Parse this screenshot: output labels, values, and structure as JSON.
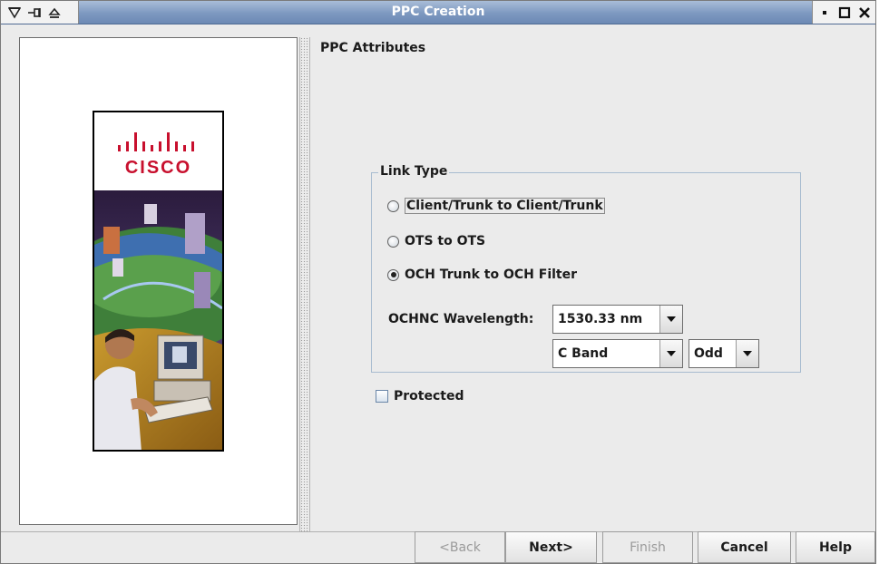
{
  "window": {
    "title": "PPC Creation",
    "left_icons": [
      "menu-triangle-icon",
      "pin-icon",
      "eject-icon"
    ],
    "right_icons": [
      "minimize-icon",
      "maximize-icon",
      "close-icon"
    ]
  },
  "logo": {
    "text": "CISCO"
  },
  "pane": {
    "header": "PPC Attributes"
  },
  "link_type": {
    "legend": "Link Type",
    "options": [
      {
        "label": "Client/Trunk to Client/Trunk",
        "selected": false
      },
      {
        "label": "OTS to OTS",
        "selected": false
      },
      {
        "label": "OCH Trunk to OCH Filter",
        "selected": true
      }
    ],
    "wavelength_label": "OCHNC Wavelength:",
    "wavelength_value": "1530.33 nm",
    "band_value": "C Band",
    "parity_value": "Odd"
  },
  "protected": {
    "label": "Protected",
    "checked": false
  },
  "buttons": {
    "back": "<Back",
    "next": "Next>",
    "finish": "Finish",
    "cancel": "Cancel",
    "help": "Help"
  }
}
